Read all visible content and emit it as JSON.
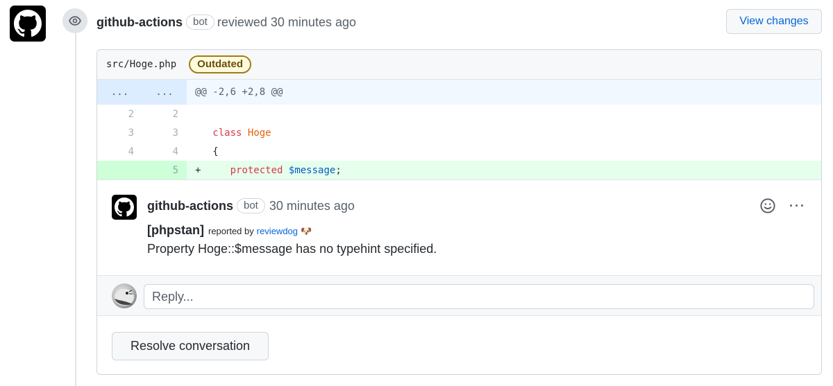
{
  "review": {
    "author": "github-actions",
    "bot_label": "bot",
    "action": "reviewed",
    "time": "30 minutes ago",
    "view_changes_label": "View changes"
  },
  "file": {
    "path": "src/Hoge.php",
    "status_badge": "Outdated"
  },
  "diff": {
    "hunk_left": "...",
    "hunk_right": "...",
    "hunk_header": "@@ -2,6 +2,8 @@",
    "lines": [
      {
        "old": "2",
        "new": "2",
        "marker": " ",
        "type": "context"
      },
      {
        "old": "3",
        "new": "3",
        "marker": " ",
        "type": "context",
        "tokens": [
          "class",
          "Hoge"
        ]
      },
      {
        "old": "4",
        "new": "4",
        "marker": " ",
        "type": "context",
        "tokens": [
          "{"
        ]
      },
      {
        "old": "",
        "new": "5",
        "marker": "+",
        "type": "added",
        "tokens": [
          "protected",
          "$message",
          ";"
        ]
      }
    ]
  },
  "comment": {
    "author": "github-actions",
    "bot_label": "bot",
    "time": "30 minutes ago",
    "tool": "[phpstan]",
    "reported_by": "reported by",
    "reporter": "reviewdog",
    "reporter_emoji": "🐶",
    "message": "Property Hoge::$message has no typehint specified.",
    "more_label": "···"
  },
  "reply": {
    "placeholder": "Reply..."
  },
  "resolve_label": "Resolve conversation",
  "icons": {
    "author_avatar": "github-octocat-icon",
    "review_event": "eye-icon",
    "reaction": "smiley-icon",
    "more": "kebab-horizontal-icon"
  },
  "colors": {
    "link": "#0366d6",
    "outdated_border": "#a37b1a",
    "added_bg": "#e6ffed",
    "hunk_bg": "#f1f8ff",
    "keyword": "#d73a49",
    "class_name": "#e36209",
    "variable": "#005cc5"
  }
}
